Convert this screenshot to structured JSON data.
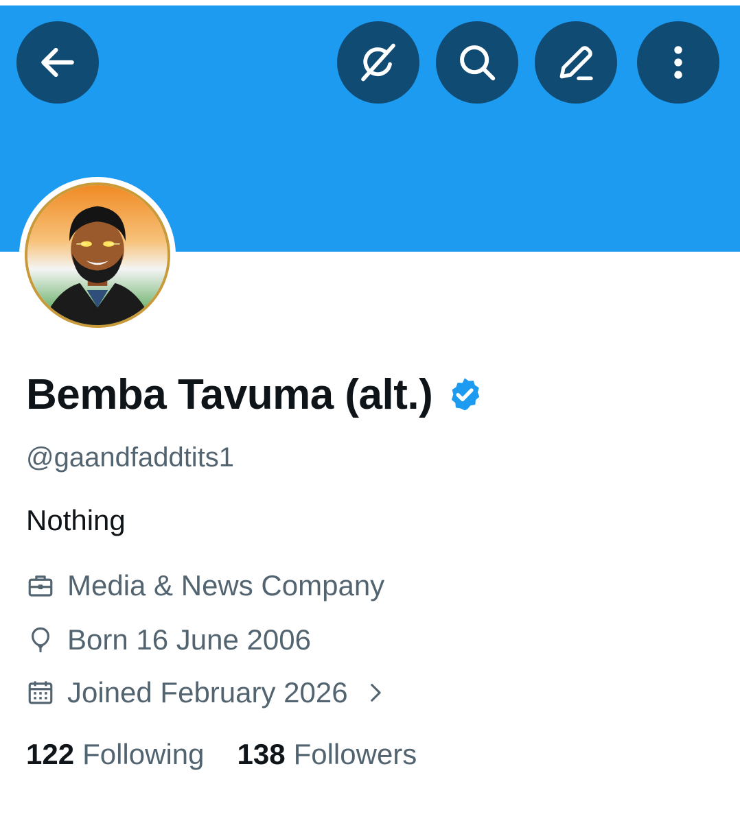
{
  "header": {
    "back_icon": "arrow-left-icon",
    "actions": [
      "grok-icon",
      "search-icon",
      "edit-icon",
      "more-vertical-icon"
    ],
    "banner_color": "#1d9bf0",
    "button_color": "#0f4b73"
  },
  "profile": {
    "display_name": "Bemba Tavuma (alt.)",
    "verified": true,
    "verified_color": "#1d9bf0",
    "handle": "@gaandfaddtits1",
    "bio": "Nothing",
    "category": "Media & News Company",
    "born": "Born 16 June 2006",
    "joined": "Joined February 2026"
  },
  "stats": {
    "following_count": "122",
    "following_label": "Following",
    "followers_count": "138",
    "followers_label": "Followers"
  }
}
